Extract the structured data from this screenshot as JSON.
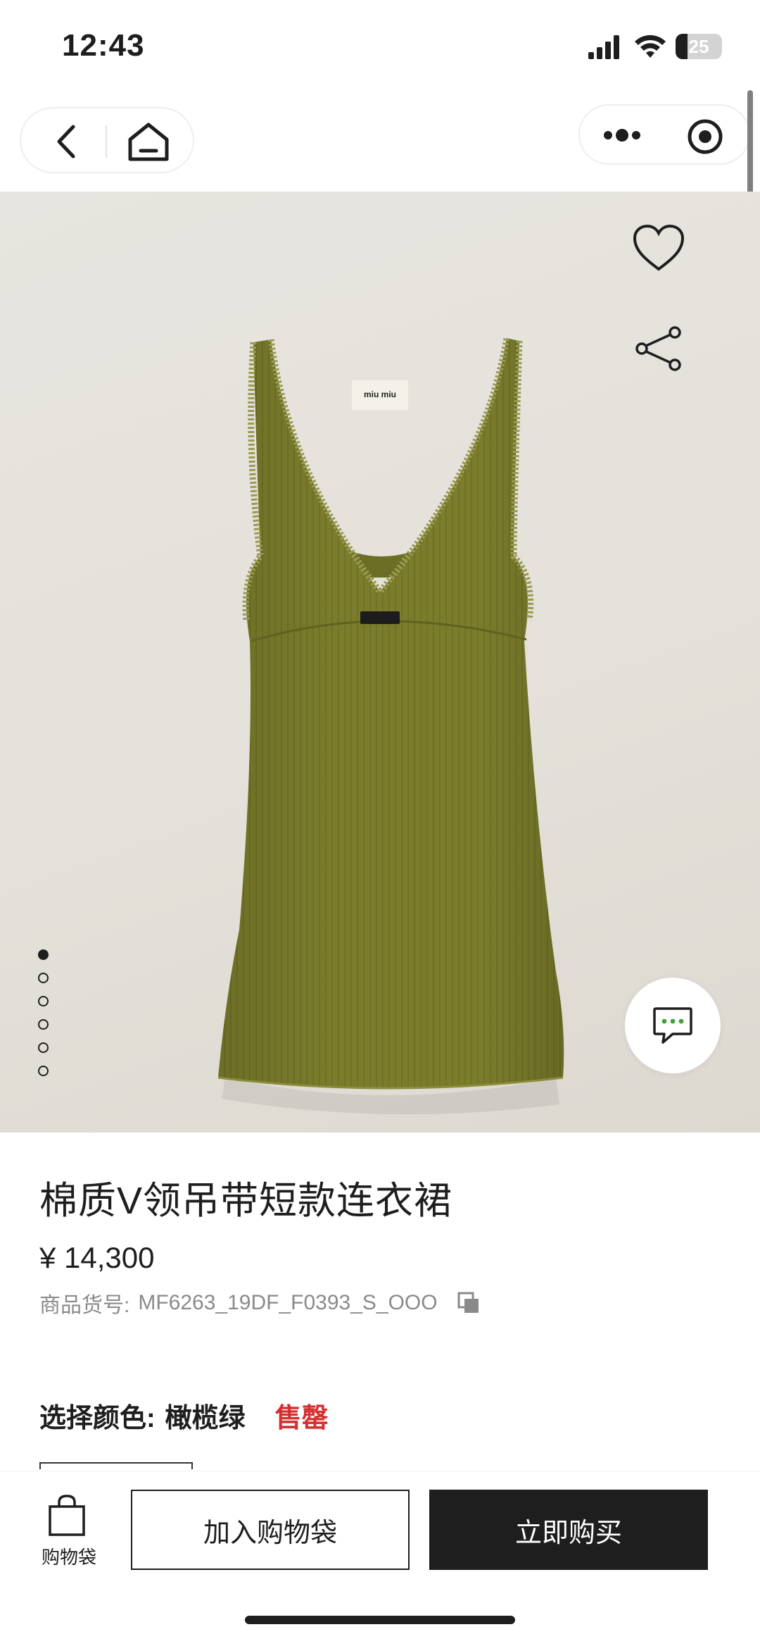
{
  "status_bar": {
    "time": "12:43",
    "battery_percent": "25",
    "battery_level": 0.25
  },
  "nav": {
    "back_icon": "chevron-left-icon",
    "home_icon": "home-icon",
    "more_icon": "more-dots-icon",
    "target_icon": "target-circle-icon"
  },
  "gallery": {
    "image": "olive-green-v-neck-ribbed-dress",
    "label_text": "miu miu",
    "page_count": 6,
    "active_index": 0,
    "favorite_icon": "heart-icon",
    "share_icon": "share-icon",
    "chat_icon": "chat-bubble-icon"
  },
  "product": {
    "name": "棉质V领吊带短款连衣裙",
    "price": "¥ 14,300",
    "sku_label": "商品货号:",
    "sku_value": "MF6263_19DF_F0393_S_OOO",
    "copy_icon": "copy-icon",
    "color_label": "选择颜色:",
    "color_value": "橄榄绿",
    "sold_out": "售罄"
  },
  "bottom_bar": {
    "bag_label": "购物袋",
    "bag_icon": "shopping-bag-icon",
    "add_to_bag": "加入购物袋",
    "buy_now": "立即购买"
  },
  "colors": {
    "accent_red": "#d3302f",
    "dark": "#1e1e1e",
    "dress_olive": "#7b7d2c",
    "gallery_bg": "#e5e2db"
  }
}
